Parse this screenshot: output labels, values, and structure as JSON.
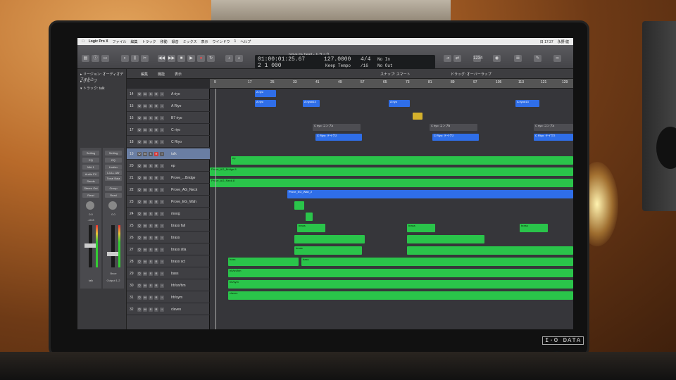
{
  "app": {
    "name": "Logic Pro X",
    "window_title": "prove my heart - トラック"
  },
  "menu": [
    "ファイル",
    "編集",
    "トラック",
    "移動",
    "録音",
    "ミックス",
    "表示",
    "ウインドウ",
    "1",
    "ヘルプ"
  ],
  "menu_status": {
    "time": "日 17:37",
    "user": "永野 健"
  },
  "lcd": {
    "position_time": "01:00:01:25.67",
    "position_bars": "2 1 000",
    "tempo": "127.0000",
    "tempo_mode": "Keep Tempo",
    "time_sig": "4/4",
    "division": "/16",
    "in_label": "No In",
    "out_label": "No Out"
  },
  "inspector": {
    "region_header": "▸ リージョン: オーディオデフォルト",
    "group_header": "▸ グループ",
    "track_header": "▾ トラック: talk",
    "strip1": {
      "setting": "Setting",
      "eq": "EQ",
      "input": "Mid 1",
      "plugin": "Audio FX",
      "send": "Sends",
      "output": "Stereo Out",
      "mode": "Read",
      "volume": "0.0",
      "peak": "-10.8",
      "name": "talk"
    },
    "strip2": {
      "setting": "Setting",
      "eq": "EQ",
      "plugin1": "Limiter",
      "plugin2": "L3-LL Ultr",
      "plugin3": "Tonal Bala",
      "group": "Group",
      "mode": "Read",
      "volume": "0.0",
      "name": "Output 1-2",
      "bounce": "Bnce"
    }
  },
  "arrange_toolbar": {
    "edit": "編集",
    "function": "機能",
    "view": "表示",
    "snap": "スナップ: スマート",
    "drag": "ドラッグ: オーバーラップ"
  },
  "ruler": [
    "9",
    "17",
    "25",
    "33",
    "41",
    "49",
    "57",
    "65",
    "73",
    "81",
    "89",
    "97",
    "105",
    "113",
    "121",
    "129"
  ],
  "tracks": [
    {
      "num": "14",
      "name": "A riyo",
      "record": false
    },
    {
      "num": "15",
      "name": "A Riyo",
      "record": false
    },
    {
      "num": "16",
      "name": "B7 riyo",
      "record": false
    },
    {
      "num": "17",
      "name": "C riyo",
      "record": false
    },
    {
      "num": "18",
      "name": "C Riyo",
      "record": false
    },
    {
      "num": "19",
      "name": "talk",
      "record": true,
      "selected": true
    },
    {
      "num": "20",
      "name": "ep",
      "record": false
    },
    {
      "num": "21",
      "name": "Prove_...Bridge",
      "record": false
    },
    {
      "num": "22",
      "name": "Prove_AG_Neck",
      "record": false
    },
    {
      "num": "23",
      "name": "Prove_EG_Wah",
      "record": false
    },
    {
      "num": "24",
      "name": "moog",
      "record": false
    },
    {
      "num": "25",
      "name": "brass fall",
      "record": false
    },
    {
      "num": "26",
      "name": "brass",
      "record": false
    },
    {
      "num": "27",
      "name": "brass stla",
      "record": false
    },
    {
      "num": "28",
      "name": "brass sct",
      "record": false
    },
    {
      "num": "29",
      "name": "bass",
      "record": false
    },
    {
      "num": "30",
      "name": "hh/sn/hm",
      "record": false
    },
    {
      "num": "31",
      "name": "hh/sym",
      "record": false
    },
    {
      "num": "32",
      "name": "claves",
      "record": false
    }
  ],
  "regions": {
    "a_riyo_label": "A riyo",
    "a_riyo2_label": "A riyo#13",
    "c_riyo_label": "C riyo: コンプA",
    "c_riyo2_label": "C Riyo: テイク2",
    "c_riyo3_label": "C riyo: コンプB",
    "bridge_label": "Prove_AG_Bridge.8",
    "neck_label": "Prove_AG_Neck.8",
    "wah_label": "Prove_EG_Wah_2",
    "brass_label": "brass",
    "bass_label": "bass",
    "hh_label": "hh/sn/hm",
    "sym_label": "hh/sym",
    "claves_label": "claves",
    "ep_label": "ep"
  },
  "bezel_brand": "I·O DATA"
}
